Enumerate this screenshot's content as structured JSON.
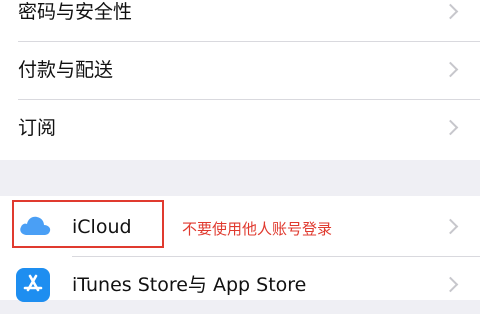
{
  "settings": {
    "group1": [
      {
        "label": "密码与安全性"
      },
      {
        "label": "付款与配送"
      },
      {
        "label": "订阅"
      }
    ],
    "group2": [
      {
        "label": "iCloud",
        "icon": "cloud-icon"
      },
      {
        "label": "iTunes Store与 App Store",
        "icon": "app-store-icon"
      }
    ]
  },
  "annotation": {
    "text": "不要使用他人账号登录",
    "color": "#e03a2f"
  },
  "colors": {
    "background": "#efeff4",
    "cloud": "#4a9ff5",
    "app_store": "#1e8ef0",
    "chevron": "#c7c7cc"
  }
}
